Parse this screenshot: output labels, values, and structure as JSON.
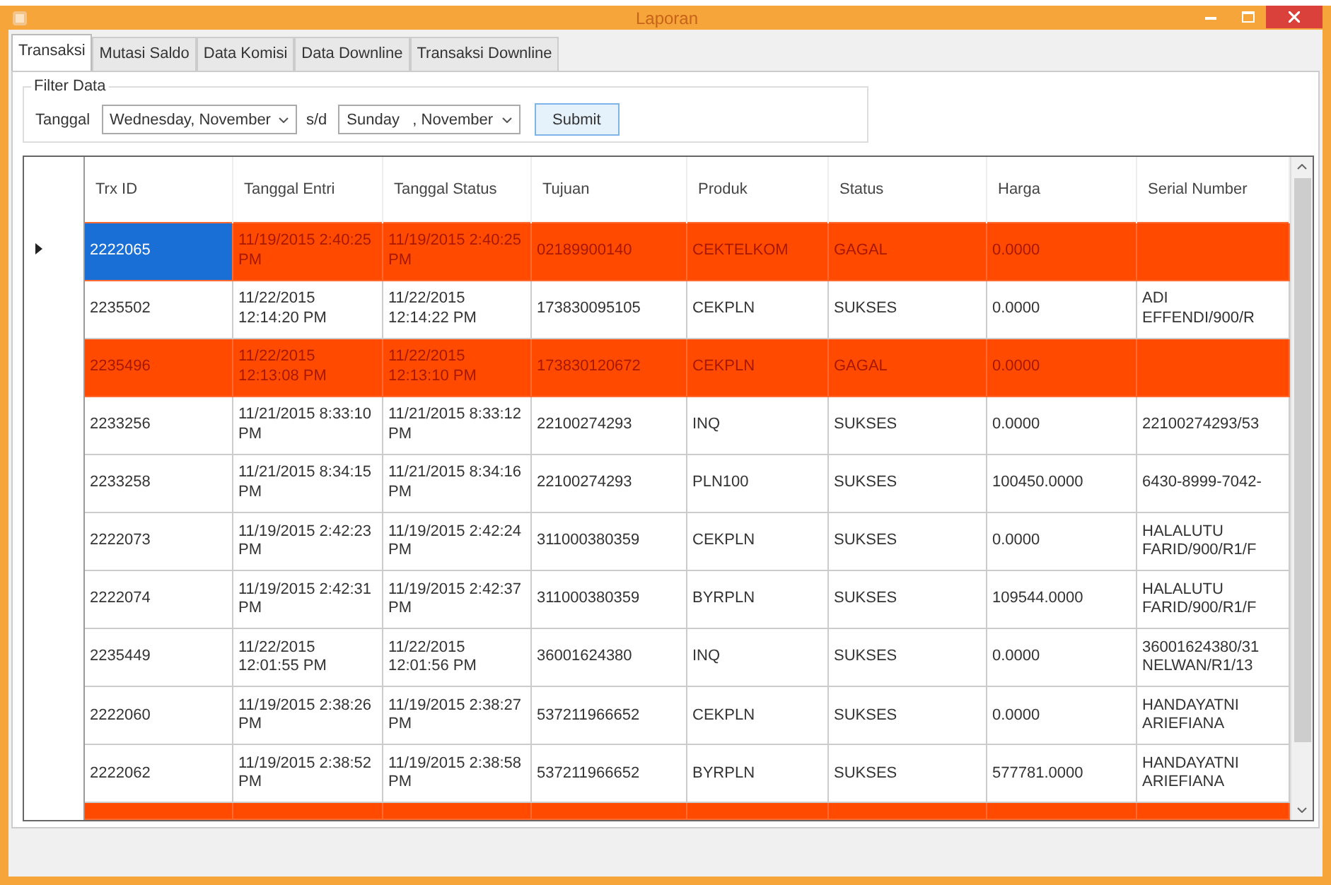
{
  "window": {
    "title": "Laporan"
  },
  "tabs": [
    {
      "label": "Transaksi",
      "selected": true
    },
    {
      "label": "Mutasi Saldo",
      "selected": false
    },
    {
      "label": "Data Komisi",
      "selected": false
    },
    {
      "label": "Data Downline",
      "selected": false
    },
    {
      "label": "Transaksi Downline",
      "selected": false
    }
  ],
  "filter": {
    "group_label": "Filter Data",
    "date_label": "Tanggal",
    "from": "Wednesday, November",
    "separator": "s/d",
    "to": "Sunday   , November",
    "submit": "Submit"
  },
  "table": {
    "columns": [
      "Trx ID",
      "Tanggal Entri",
      "Tanggal Status",
      "Tujuan",
      "Produk",
      "Status",
      "Harga",
      "Serial Number"
    ],
    "rows": [
      {
        "selected": true,
        "highlighted": true,
        "cells": [
          "2222065",
          "11/19/2015 2:40:25 PM",
          "11/19/2015 2:40:25 PM",
          "02189900140",
          "CEKTELKOM",
          "GAGAL",
          "0.0000",
          ""
        ]
      },
      {
        "selected": false,
        "highlighted": false,
        "cells": [
          "2235502",
          "11/22/2015 12:14:20 PM",
          "11/22/2015 12:14:22 PM",
          "173830095105",
          "CEKPLN",
          "SUKSES",
          "0.0000",
          "ADI EFFENDI/900/R"
        ]
      },
      {
        "selected": false,
        "highlighted": true,
        "cells": [
          "2235496",
          "11/22/2015 12:13:08 PM",
          "11/22/2015 12:13:10 PM",
          "173830120672",
          "CEKPLN",
          "GAGAL",
          "0.0000",
          ""
        ]
      },
      {
        "selected": false,
        "highlighted": false,
        "cells": [
          "2233256",
          "11/21/2015 8:33:10 PM",
          "11/21/2015 8:33:12 PM",
          "22100274293",
          "INQ",
          "SUKSES",
          "0.0000",
          "22100274293/53"
        ]
      },
      {
        "selected": false,
        "highlighted": false,
        "cells": [
          "2233258",
          "11/21/2015 8:34:15 PM",
          "11/21/2015 8:34:16 PM",
          "22100274293",
          "PLN100",
          "SUKSES",
          "100450.0000",
          "6430-8999-7042-"
        ]
      },
      {
        "selected": false,
        "highlighted": false,
        "cells": [
          "2222073",
          "11/19/2015 2:42:23 PM",
          "11/19/2015 2:42:24 PM",
          "311000380359",
          "CEKPLN",
          "SUKSES",
          "0.0000",
          "HALALUTU FARID/900/R1/F"
        ]
      },
      {
        "selected": false,
        "highlighted": false,
        "cells": [
          "2222074",
          "11/19/2015 2:42:31 PM",
          "11/19/2015 2:42:37 PM",
          "311000380359",
          "BYRPLN",
          "SUKSES",
          "109544.0000",
          "HALALUTU FARID/900/R1/F"
        ]
      },
      {
        "selected": false,
        "highlighted": false,
        "cells": [
          "2235449",
          "11/22/2015 12:01:55 PM",
          "11/22/2015 12:01:56 PM",
          "36001624380",
          "INQ",
          "SUKSES",
          "0.0000",
          "36001624380/31 NELWAN/R1/13"
        ]
      },
      {
        "selected": false,
        "highlighted": false,
        "cells": [
          "2222060",
          "11/19/2015 2:38:26 PM",
          "11/19/2015 2:38:27 PM",
          "537211966652",
          "CEKPLN",
          "SUKSES",
          "0.0000",
          "HANDAYATNI ARIEFIANA"
        ]
      },
      {
        "selected": false,
        "highlighted": false,
        "cells": [
          "2222062",
          "11/19/2015 2:38:52 PM",
          "11/19/2015 2:38:58 PM",
          "537211966652",
          "BYRPLN",
          "SUKSES",
          "577781.0000",
          "HANDAYATNI ARIEFIANA"
        ]
      },
      {
        "selected": false,
        "highlighted": true
      }
    ]
  }
}
